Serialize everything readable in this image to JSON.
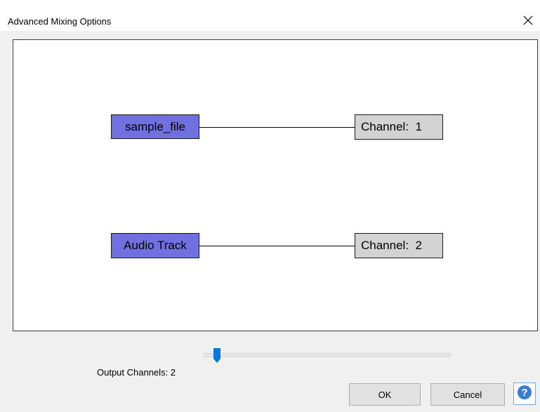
{
  "window": {
    "title": "Advanced Mixing Options"
  },
  "mixer": {
    "tracks": [
      {
        "label": "sample_file",
        "channel_label": "Channel:  1"
      },
      {
        "label": "Audio Track",
        "channel_label": "Channel:  2"
      }
    ]
  },
  "output": {
    "label": "Output Channels:  2",
    "channels": 2
  },
  "buttons": {
    "ok": "OK",
    "cancel": "Cancel",
    "help_glyph": "?"
  },
  "colors": {
    "track_fill": "#7070e0",
    "channel_fill": "#d3d3d3",
    "slider_thumb": "#0078d7",
    "help_accent": "#3a7bd5"
  },
  "icons": {
    "close": "close-icon",
    "help": "help-icon",
    "slider_thumb": "slider-thumb-icon"
  }
}
